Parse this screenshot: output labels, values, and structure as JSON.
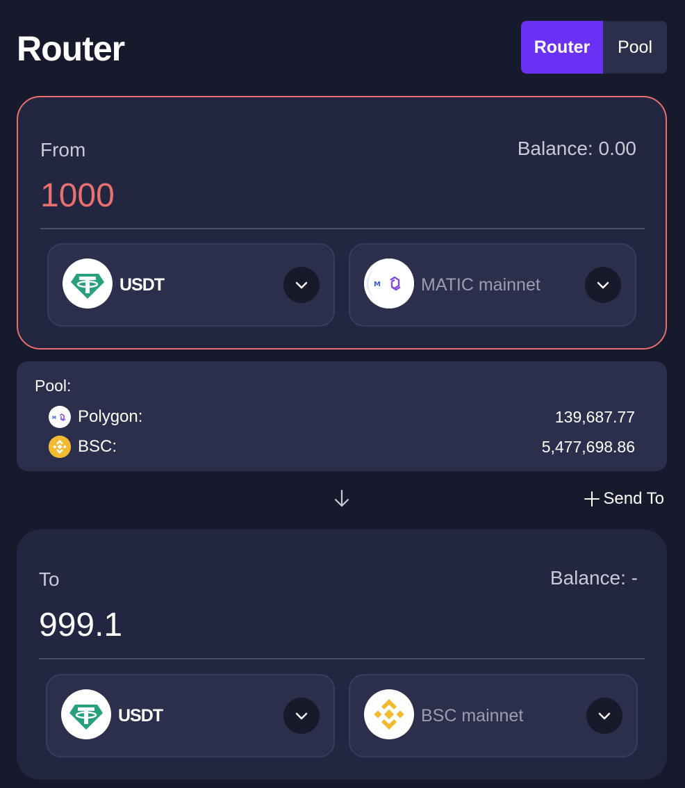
{
  "header": {
    "title": "Router",
    "tabs": [
      {
        "label": "Router",
        "active": true
      },
      {
        "label": "Pool",
        "active": false
      }
    ]
  },
  "from": {
    "label": "From",
    "balance": "Balance: 0.00",
    "amount": "1000",
    "token": {
      "symbol": "USDT",
      "icon": "usdt-icon"
    },
    "chain": {
      "name": "MATIC mainnet",
      "icon": "polygon-icon"
    }
  },
  "pool": {
    "title": "Pool:",
    "rows": [
      {
        "name": "Polygon:",
        "value": "139,687.77",
        "icon": "polygon-icon"
      },
      {
        "name": "BSC:",
        "value": "5,477,698.86",
        "icon": "bnb-icon"
      }
    ]
  },
  "actions": {
    "send_to": "Send To"
  },
  "to": {
    "label": "To",
    "balance": "Balance: -",
    "amount": "999.1",
    "token": {
      "symbol": "USDT",
      "icon": "usdt-icon"
    },
    "chain": {
      "name": "BSC mainnet",
      "icon": "bnb-icon"
    }
  },
  "colors": {
    "background": "#171a2d",
    "card": "#232640",
    "accent": "#6a31f5",
    "error": "#e8706e",
    "usdt": "#26a17b",
    "bnb": "#f3ba2f",
    "polygon": "#8247e5"
  }
}
